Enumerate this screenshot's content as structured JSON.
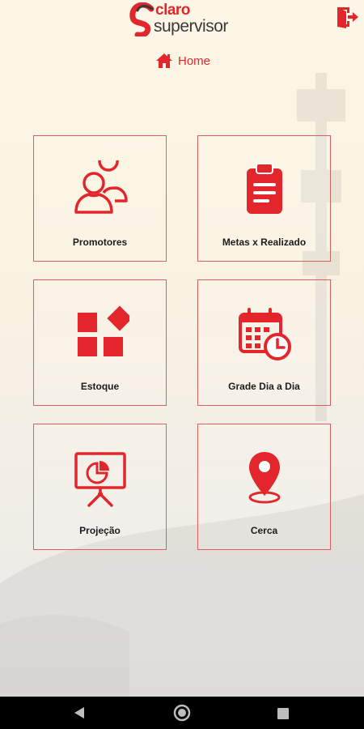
{
  "app": {
    "logo_top": "claro",
    "logo_bottom": "supervisor"
  },
  "breadcrumb": {
    "label": "Home"
  },
  "tiles": [
    {
      "label": "Promotores",
      "icon": "people-icon"
    },
    {
      "label": "Metas x Realizado",
      "icon": "clipboard-icon"
    },
    {
      "label": "Estoque",
      "icon": "stock-shapes-icon"
    },
    {
      "label": "Grade Dia a Dia",
      "icon": "calendar-clock-icon"
    },
    {
      "label": "Projeção",
      "icon": "presentation-chart-icon"
    },
    {
      "label": "Cerca",
      "icon": "map-pin-icon"
    }
  ],
  "colors": {
    "accent": "#e3262b",
    "text": "#1c1c1c"
  }
}
